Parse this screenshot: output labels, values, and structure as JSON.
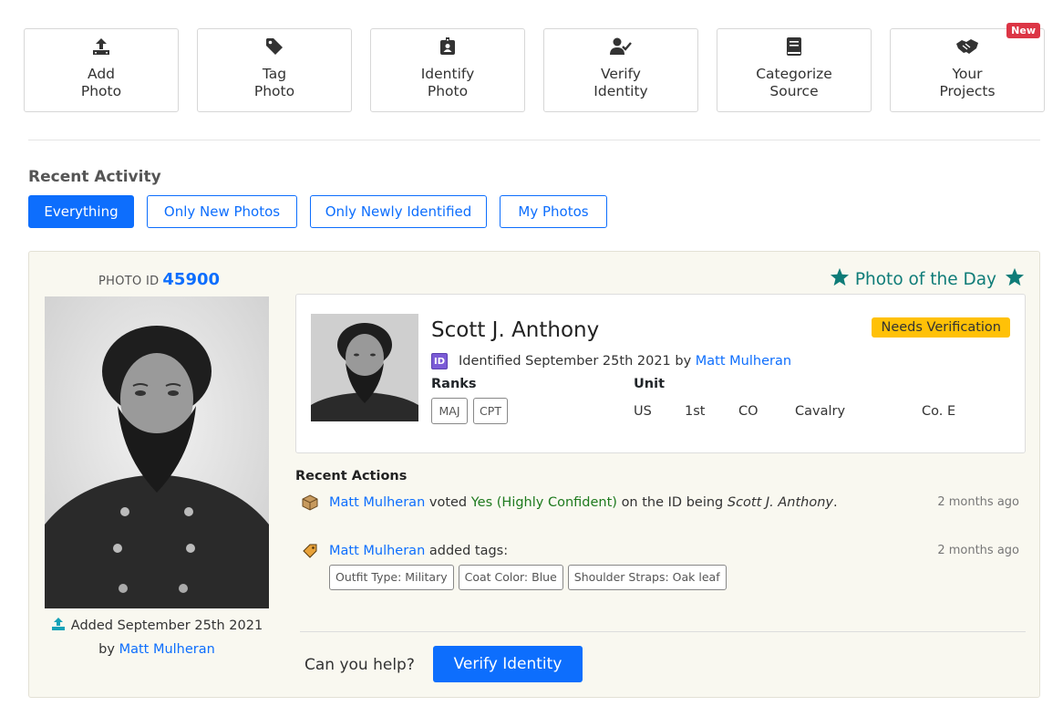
{
  "actions": [
    {
      "line1": "Add",
      "line2": "Photo",
      "icon": "upload-icon"
    },
    {
      "line1": "Tag",
      "line2": "Photo",
      "icon": "tag-icon"
    },
    {
      "line1": "Identify",
      "line2": "Photo",
      "icon": "id-badge-icon"
    },
    {
      "line1": "Verify",
      "line2": "Identity",
      "icon": "user-check-icon"
    },
    {
      "line1": "Categorize",
      "line2": "Source",
      "icon": "book-icon"
    },
    {
      "line1": "Your",
      "line2": "Projects",
      "icon": "handshake-icon",
      "badge": "New"
    }
  ],
  "recent_activity": {
    "title": "Recent Activity",
    "filters": [
      "Everything",
      "Only New Photos",
      "Only Newly Identified",
      "My Photos"
    ],
    "active_filter": "Everything"
  },
  "photo": {
    "id_label": "PHOTO ID",
    "id": "45900",
    "potd": "Photo of the Day",
    "added_prefix": "Added September 25th 2021",
    "by": "by",
    "added_by": "Matt Mulheran"
  },
  "identity": {
    "name": "Scott J. Anthony",
    "status": "Needs Verification",
    "id_icon_text": "ID",
    "identified_text": "Identified September 25th 2021 by",
    "identified_by": "Matt Mulheran",
    "ranks_label": "Ranks",
    "ranks": [
      "MAJ",
      "CPT"
    ],
    "unit_label": "Unit",
    "unit": [
      "US",
      "1st",
      "CO",
      "Cavalry",
      "Co. E"
    ]
  },
  "recent_actions": {
    "title": "Recent Actions",
    "vote": {
      "user": "Matt Mulheran",
      "verb": "voted",
      "vote": "Yes (Highly Confident)",
      "middle": "on the ID being",
      "subject": "Scott J. Anthony",
      "end": ".",
      "time": "2 months ago"
    },
    "tags": {
      "user": "Matt Mulheran",
      "verb": "added tags:",
      "time": "2 months ago",
      "items": [
        "Outfit Type: Military",
        "Coat Color: Blue",
        "Shoulder Straps: Oak leaf"
      ]
    }
  },
  "footer": {
    "help": "Can you help?",
    "button": "Verify Identity"
  },
  "colors": {
    "primary": "#0d6efd",
    "teal": "#0f7c78",
    "warning": "#ffc107",
    "danger": "#dc3545"
  }
}
